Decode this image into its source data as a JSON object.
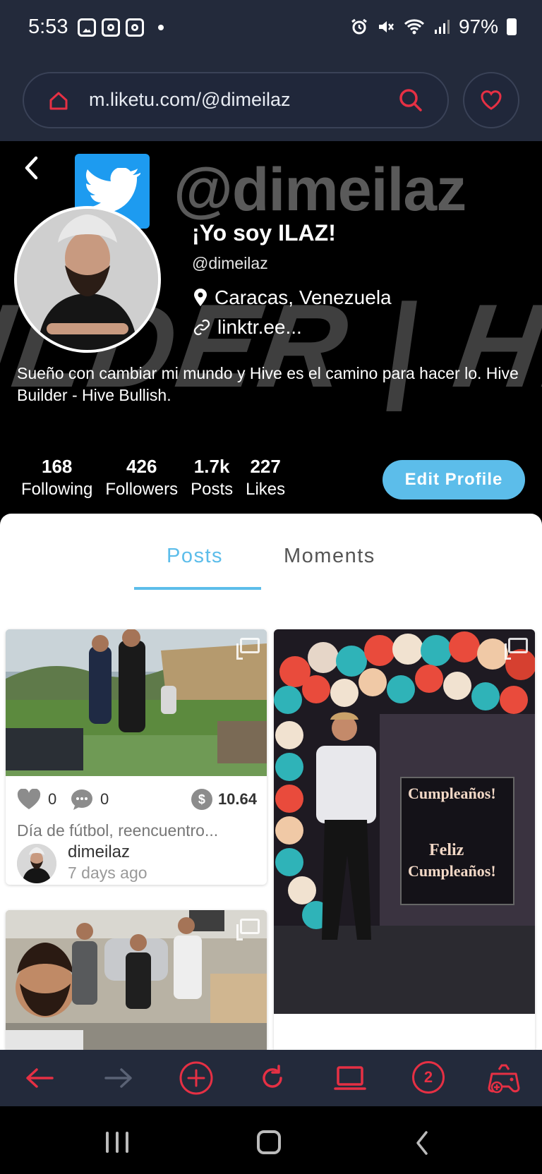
{
  "status_bar": {
    "time": "5:53",
    "battery": "97%"
  },
  "browser": {
    "url": "m.liketu.com/@dimeilaz"
  },
  "cover": {
    "handle_text": "@dimeilaz",
    "banner_text": "ILDER | HIVE"
  },
  "profile": {
    "name": "¡Yo soy ILAZ!",
    "handle": "@dimeilaz",
    "location": "Caracas, Venezuela",
    "link": "linktr.ee...",
    "bio": "Sueño con cambiar mi mundo y Hive es el camino para hacer lo. Hive Builder - Hive Bullish.",
    "stats": [
      {
        "value": "168",
        "label": "Following"
      },
      {
        "value": "426",
        "label": "Followers"
      },
      {
        "value": "1.7k",
        "label": "Posts"
      },
      {
        "value": "227",
        "label": "Likes"
      }
    ],
    "edit_label": "Edit Profile"
  },
  "tabs": {
    "posts": "Posts",
    "moments": "Moments",
    "active": "Posts"
  },
  "posts": [
    {
      "likes": "0",
      "comments": "0",
      "payout": "10.64",
      "title": "Día de fútbol, reencuentro...",
      "author": "dimeilaz",
      "time": "7 days ago"
    }
  ],
  "banner_in_photo": {
    "line1": "Cumpleaños!",
    "line2": "Feliz",
    "line3": "Cumpleaños!"
  },
  "toolbar": {
    "tab_count": "2"
  },
  "colors": {
    "accent": "#5cbdea",
    "browser_red": "#e63044",
    "chrome": "#232a3b"
  },
  "icons": {
    "status": [
      "gallery-icon",
      "instagram-icon",
      "instagram-icon",
      "alarm-icon",
      "mute-icon",
      "wifi-icon",
      "signal-icon",
      "battery-icon"
    ],
    "toolbar": [
      "back-arrow-icon",
      "forward-arrow-icon",
      "add-icon",
      "refresh-icon",
      "desktop-icon",
      "tabs-icon",
      "game-icon"
    ]
  }
}
